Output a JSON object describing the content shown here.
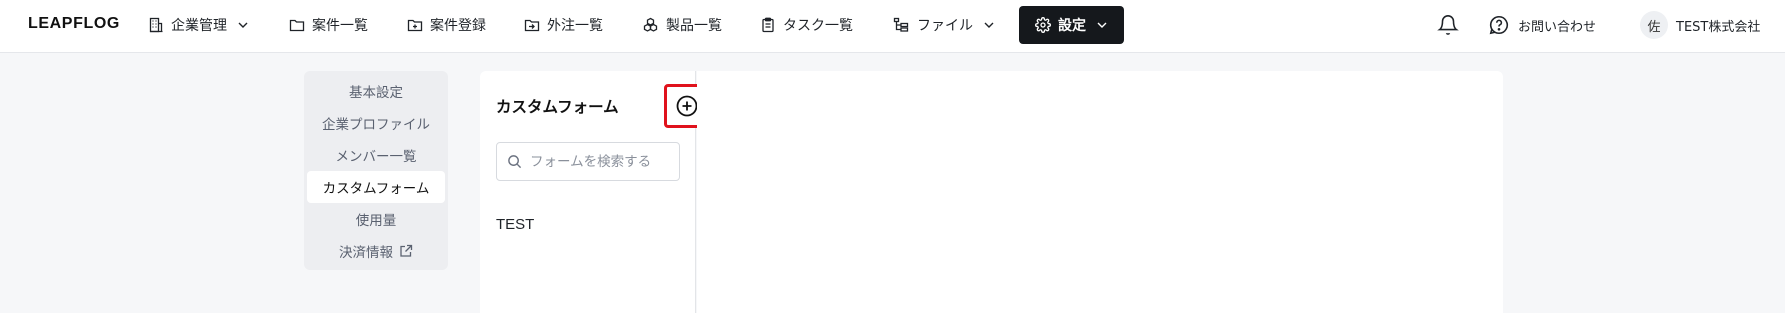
{
  "brand": {
    "logo_text": "LEAPFLOG"
  },
  "nav": {
    "company_management": "企業管理",
    "cases_list": "案件一覧",
    "case_register": "案件登録",
    "outsourcing_list": "外注一覧",
    "products_list": "製品一覧",
    "tasks_list": "タスク一覧",
    "files": "ファイル",
    "settings": "設定"
  },
  "header_right": {
    "contact": "お問い合わせ",
    "avatar_initial": "佐",
    "company_name": "TEST株式会社"
  },
  "settings_menu": {
    "items": [
      {
        "label": "基本設定"
      },
      {
        "label": "企業プロファイル"
      },
      {
        "label": "メンバー一覧"
      },
      {
        "label": "カスタムフォーム",
        "active": true
      },
      {
        "label": "使用量"
      },
      {
        "label": "決済情報",
        "external": true
      }
    ]
  },
  "forms_panel": {
    "title": "カスタムフォーム",
    "search_placeholder": "フォームを検索する",
    "forms": [
      {
        "name": "TEST"
      }
    ]
  },
  "colors": {
    "active_nav_bg": "#15181c",
    "highlight_border": "#e0121c",
    "page_bg": "#f6f7f9"
  }
}
